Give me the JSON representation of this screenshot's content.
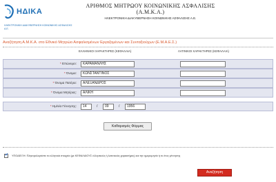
{
  "header": {
    "brand": "ΗΔΙΚΑ",
    "brand_tagline": "ΗΛΕΚΤΡΟΝΙΚΗ ΔΙΑΚΥΒΕΡΝΗΣΗ ΚΟΙΝΩΝΙΚΗΣ ΑΣΦΑΛΙΣΗΣ Α.Ε.",
    "title_line1": "ΑΡΙΘΜΟΣ ΜΗΤΡΩΟΥ ΚΟΙΝΩΝΙΚΗΣ ΑΣΦΑΛΙΣΗΣ",
    "title_line2": "(Α.Μ.Κ.Α.)",
    "company": "ΗΛΕΚΤΡΟΝΙΚΗ ΔΙΑΚΥΒΕΡΝΗΣΗ ΚΟΙΝΩΝΙΚΗΣ ΑΣΦΑΛΙΣΗΣ Α.Ε."
  },
  "form": {
    "title": "Αναζήτηση Α.Μ.Κ.Α. στο Εθνικό Μητρώο Ασφαλισμένων Εργαζομένων και Συνταξιούχων (Ε.Μ.Α.Ε.Σ.)",
    "col_greek": "ΕΛΛΗΝΙΚΟΙ ΧΑΡΑΚΤΗΡΕΣ (ΚΕΦΑΛΑΙΑ)",
    "col_latin": "ΛΑΤΙΝΙΚΟΙ ΧΑΡΑΚΤΗΡΕΣ (ΚΕΦΑΛΑΙΑ)",
    "fields": [
      {
        "label": "Επώνυμο:",
        "greek": "ΚΑΡΑΜΑΝΛΗΣ",
        "latin": ""
      },
      {
        "label": "Όνομα:",
        "greek": "ΚΩΝΣΤΑΝΤΙΝΟΣ",
        "latin": ""
      },
      {
        "label": "Όνομα Πατέρα:",
        "greek": "ΑΛΕΞΑΝΔΡΟΣ",
        "latin": ""
      },
      {
        "label": "Όνομα Μητέρας:",
        "greek": "ΑΛΙΚΗ",
        "latin": ""
      }
    ],
    "birth": {
      "label": "Ημ/νία Γέννησης:",
      "day": "14",
      "month": "09",
      "year": "1956",
      "separator": "/"
    },
    "required_mark": "*",
    "clear_label": "Καθαρισμός Φόρμας",
    "consent_text": "ΥΠΟΔΕΙΞΗ: Πληκτρολογείστε τα ελληνικά στοιχεία (με ΚΕΦΑΛΑΙΟΥΣ ελληνικούς ή λατινικούς χαρακτήρες) και την ημερομηνία ή το έτος γέννησης",
    "consent_checked": true,
    "search_label": "Αναζήτηση"
  },
  "colors": {
    "accent": "#d9572b",
    "brand": "#1f6fb5",
    "row_bg": "#e4e6f0",
    "button_red": "#d32b1f"
  },
  "icons": {
    "logo": "hdika-logo-icon",
    "check": "check-icon"
  }
}
